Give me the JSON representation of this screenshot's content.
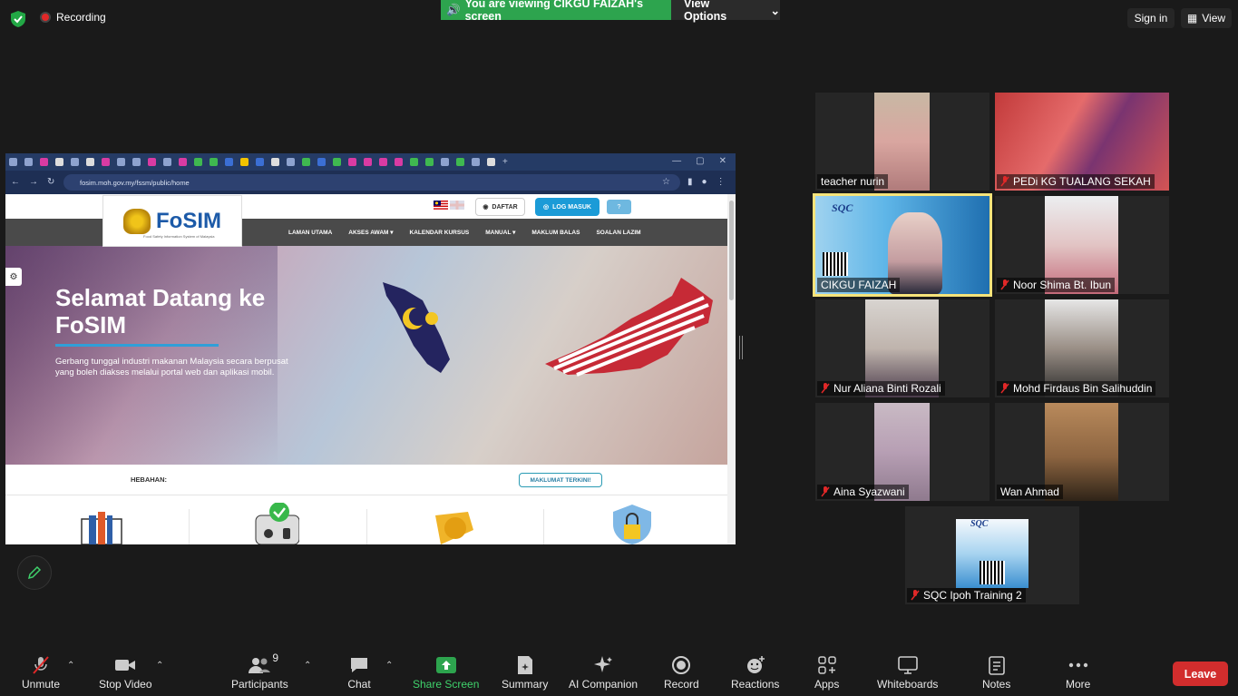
{
  "topbar": {
    "recording_label": "Recording",
    "viewing_text": "You are viewing CIKGU FAIZAH's screen",
    "view_options": "View Options",
    "sign_in": "Sign in",
    "view": "View"
  },
  "shared_screen": {
    "url": "fosim.moh.gov.my/fssm/public/home",
    "logo_text": "FoSIM",
    "logo_subtitle": "Food Safety Information System of Malaysia",
    "daftar": "DAFTAR",
    "log_masuk": "LOG MASUK",
    "help": "?",
    "menu": [
      "LAMAN UTAMA",
      "AKSES AWAM ▾",
      "KALENDAR KURSUS",
      "MANUAL ▾",
      "MAKLUM BALAS",
      "SOALAN LAZIM"
    ],
    "hero_title": "Selamat Datang ke FoSIM",
    "hero_desc": "Gerbang tunggal industri makanan Malaysia secara berpusat yang boleh diakses melalui portal web dan aplikasi mobil.",
    "hebahan": "HEBAHAN:",
    "maklumat_terkini": "MAKLUMAT TERKINI!"
  },
  "participants": [
    {
      "name": "teacher nurin",
      "muted": false
    },
    {
      "name": "PEDi KG TUALANG SEKAH",
      "muted": true
    },
    {
      "name": "CIKGU FAIZAH",
      "muted": false
    },
    {
      "name": "Noor Shima Bt. Ibun",
      "muted": true
    },
    {
      "name": "Nur Aliana Binti Rozali",
      "muted": true
    },
    {
      "name": "Mohd Firdaus Bin Salihuddin",
      "muted": true
    },
    {
      "name": "Aina Syazwani",
      "muted": true
    },
    {
      "name": "Wan Ahmad",
      "muted": false
    },
    {
      "name": "SQC Ipoh Training 2",
      "muted": true
    }
  ],
  "toolbar": {
    "unmute": "Unmute",
    "stop_video": "Stop Video",
    "participants": "Participants",
    "participants_count": "9",
    "chat": "Chat",
    "share_screen": "Share Screen",
    "summary": "Summary",
    "ai_companion": "AI Companion",
    "record": "Record",
    "reactions": "Reactions",
    "apps": "Apps",
    "whiteboards": "Whiteboards",
    "notes": "Notes",
    "more": "More",
    "leave": "Leave"
  },
  "colors": {
    "viewing_banner": "#2da44e",
    "share_green": "#2da44e",
    "leave_red": "#d22d2d",
    "active_speaker_border": "#f5e37a"
  }
}
